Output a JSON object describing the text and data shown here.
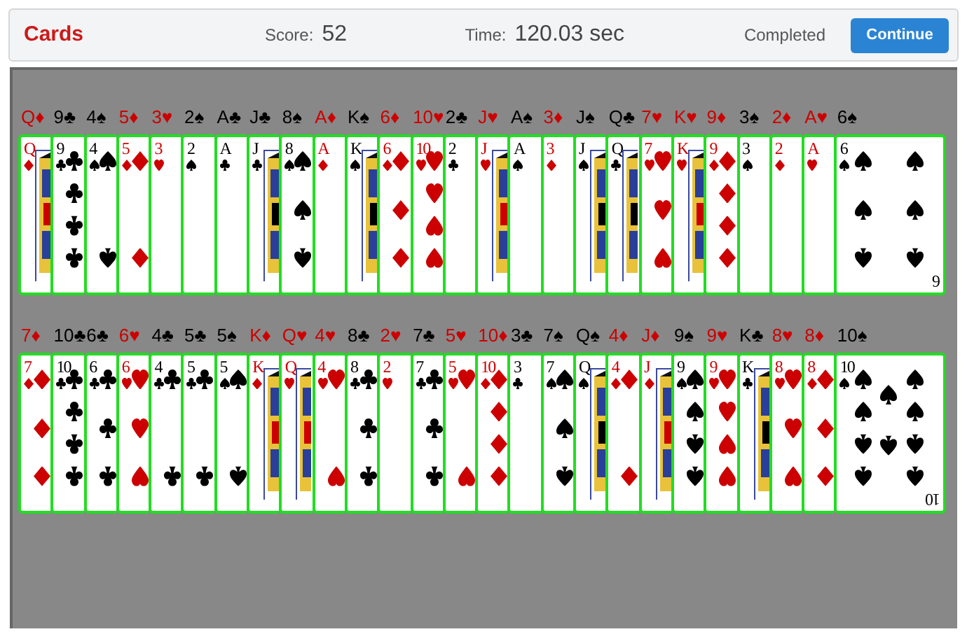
{
  "header": {
    "title": "Cards",
    "score_label": "Score:",
    "score": "52",
    "time_label": "Time:",
    "time": "120.03 sec",
    "status": "Completed",
    "button": "Continue"
  },
  "rows": [
    {
      "cards": [
        {
          "label": "Q♦",
          "rank": "Q",
          "kind": "diamond",
          "face": true,
          "color": "#cc0000"
        },
        {
          "label": "9♣",
          "rank": "9",
          "kind": "club",
          "face": false,
          "color": "#000000"
        },
        {
          "label": "4♠",
          "rank": "4",
          "kind": "spade",
          "face": false,
          "color": "#000000"
        },
        {
          "label": "5♦",
          "rank": "5",
          "kind": "diamond",
          "face": false,
          "color": "#cc0000"
        },
        {
          "label": "3♥",
          "rank": "3",
          "kind": "heart",
          "face": false,
          "color": "#cc0000"
        },
        {
          "label": "2♠",
          "rank": "2",
          "kind": "spade",
          "face": false,
          "color": "#000000"
        },
        {
          "label": "A♣",
          "rank": "A",
          "kind": "club",
          "face": false,
          "color": "#000000"
        },
        {
          "label": "J♣",
          "rank": "J",
          "kind": "club",
          "face": true,
          "color": "#000000"
        },
        {
          "label": "8♠",
          "rank": "8",
          "kind": "spade",
          "face": false,
          "color": "#000000"
        },
        {
          "label": "A♦",
          "rank": "A",
          "kind": "diamond",
          "face": false,
          "color": "#cc0000"
        },
        {
          "label": "K♠",
          "rank": "K",
          "kind": "spade",
          "face": true,
          "color": "#000000"
        },
        {
          "label": "6♦",
          "rank": "6",
          "kind": "diamond",
          "face": false,
          "color": "#cc0000"
        },
        {
          "label": "10♥",
          "rank": "10",
          "kind": "heart",
          "face": false,
          "color": "#cc0000"
        },
        {
          "label": "2♣",
          "rank": "2",
          "kind": "club",
          "face": false,
          "color": "#000000"
        },
        {
          "label": "J♥",
          "rank": "J",
          "kind": "heart",
          "face": true,
          "color": "#cc0000"
        },
        {
          "label": "A♠",
          "rank": "A",
          "kind": "spade",
          "face": false,
          "color": "#000000"
        },
        {
          "label": "3♦",
          "rank": "3",
          "kind": "diamond",
          "face": false,
          "color": "#cc0000"
        },
        {
          "label": "J♠",
          "rank": "J",
          "kind": "spade",
          "face": true,
          "color": "#000000"
        },
        {
          "label": "Q♣",
          "rank": "Q",
          "kind": "club",
          "face": true,
          "color": "#000000"
        },
        {
          "label": "7♥",
          "rank": "7",
          "kind": "heart",
          "face": false,
          "color": "#cc0000"
        },
        {
          "label": "K♥",
          "rank": "K",
          "kind": "heart",
          "face": true,
          "color": "#cc0000"
        },
        {
          "label": "9♦",
          "rank": "9",
          "kind": "diamond",
          "face": false,
          "color": "#cc0000"
        },
        {
          "label": "3♠",
          "rank": "3",
          "kind": "spade",
          "face": false,
          "color": "#000000"
        },
        {
          "label": "2♦",
          "rank": "2",
          "kind": "diamond",
          "face": false,
          "color": "#cc0000"
        },
        {
          "label": "A♥",
          "rank": "A",
          "kind": "heart",
          "face": false,
          "color": "#cc0000"
        },
        {
          "label": "6♠",
          "rank": "6",
          "kind": "spade",
          "face": false,
          "color": "#000000",
          "bottom_rank": "6"
        }
      ]
    },
    {
      "cards": [
        {
          "label": "7♦",
          "rank": "7",
          "kind": "diamond",
          "face": false,
          "color": "#cc0000"
        },
        {
          "label": "10♣",
          "rank": "10",
          "kind": "club",
          "face": false,
          "color": "#000000"
        },
        {
          "label": "6♣",
          "rank": "6",
          "kind": "club",
          "face": false,
          "color": "#000000"
        },
        {
          "label": "6♥",
          "rank": "6",
          "kind": "heart",
          "face": false,
          "color": "#cc0000"
        },
        {
          "label": "4♣",
          "rank": "4",
          "kind": "club",
          "face": false,
          "color": "#000000"
        },
        {
          "label": "5♣",
          "rank": "5",
          "kind": "club",
          "face": false,
          "color": "#000000"
        },
        {
          "label": "5♠",
          "rank": "5",
          "kind": "spade",
          "face": false,
          "color": "#000000"
        },
        {
          "label": "K♦",
          "rank": "K",
          "kind": "diamond",
          "face": true,
          "color": "#cc0000"
        },
        {
          "label": "Q♥",
          "rank": "Q",
          "kind": "heart",
          "face": true,
          "color": "#cc0000"
        },
        {
          "label": "4♥",
          "rank": "4",
          "kind": "heart",
          "face": false,
          "color": "#cc0000"
        },
        {
          "label": "8♣",
          "rank": "8",
          "kind": "club",
          "face": false,
          "color": "#000000"
        },
        {
          "label": "2♥",
          "rank": "2",
          "kind": "heart",
          "face": false,
          "color": "#cc0000"
        },
        {
          "label": "7♣",
          "rank": "7",
          "kind": "club",
          "face": false,
          "color": "#000000"
        },
        {
          "label": "5♥",
          "rank": "5",
          "kind": "heart",
          "face": false,
          "color": "#cc0000"
        },
        {
          "label": "10♦",
          "rank": "10",
          "kind": "diamond",
          "face": false,
          "color": "#cc0000"
        },
        {
          "label": "3♣",
          "rank": "3",
          "kind": "club",
          "face": false,
          "color": "#000000"
        },
        {
          "label": "7♠",
          "rank": "7",
          "kind": "spade",
          "face": false,
          "color": "#000000"
        },
        {
          "label": "Q♠",
          "rank": "Q",
          "kind": "spade",
          "face": true,
          "color": "#000000"
        },
        {
          "label": "4♦",
          "rank": "4",
          "kind": "diamond",
          "face": false,
          "color": "#cc0000"
        },
        {
          "label": "J♦",
          "rank": "J",
          "kind": "diamond",
          "face": true,
          "color": "#cc0000"
        },
        {
          "label": "9♠",
          "rank": "9",
          "kind": "spade",
          "face": false,
          "color": "#000000"
        },
        {
          "label": "9♥",
          "rank": "9",
          "kind": "heart",
          "face": false,
          "color": "#cc0000"
        },
        {
          "label": "K♣",
          "rank": "K",
          "kind": "club",
          "face": true,
          "color": "#000000"
        },
        {
          "label": "8♥",
          "rank": "8",
          "kind": "heart",
          "face": false,
          "color": "#cc0000"
        },
        {
          "label": "8♦",
          "rank": "8",
          "kind": "diamond",
          "face": false,
          "color": "#cc0000"
        },
        {
          "label": "10♠",
          "rank": "10",
          "kind": "spade",
          "face": false,
          "color": "#000000",
          "bottom_rank": "10"
        }
      ]
    }
  ]
}
